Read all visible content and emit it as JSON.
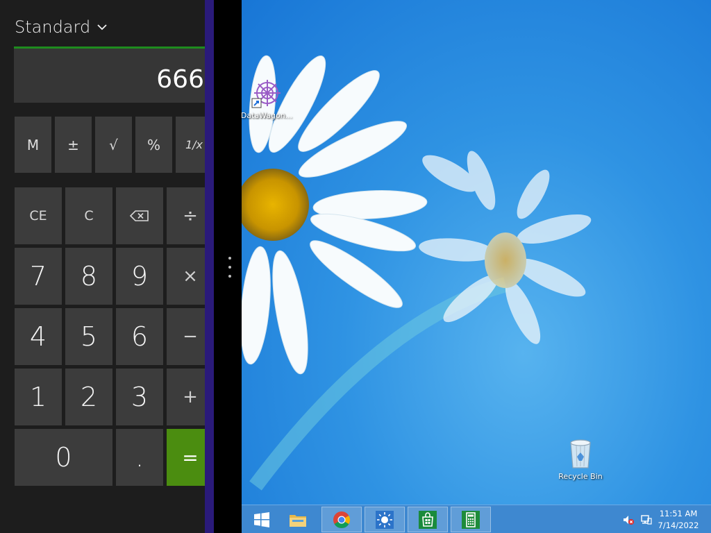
{
  "calculator": {
    "mode": "Standard",
    "display_value": "666",
    "memory_keys": [
      "M",
      "±",
      "√",
      "%",
      "1/x"
    ],
    "keys": {
      "ce": "CE",
      "c": "C",
      "divide": "÷",
      "seven": "7",
      "eight": "8",
      "nine": "9",
      "multiply": "×",
      "four": "4",
      "five": "5",
      "six": "6",
      "minus": "−",
      "one": "1",
      "two": "2",
      "three": "3",
      "plus": "+",
      "zero": "0",
      "point": ".",
      "equals": "="
    },
    "accent_color": "#1e8c1e",
    "equals_color": "#4b8d10"
  },
  "desktop": {
    "icons": [
      {
        "label": "DataWagon...",
        "icon": "datawagon-shortcut-icon"
      },
      {
        "label": "Recycle Bin",
        "icon": "recycle-bin-icon"
      }
    ]
  },
  "taskbar": {
    "items": [
      "start-icon",
      "file-explorer-icon",
      "chrome-icon",
      "weather-app-icon",
      "store-icon",
      "calculator-app-icon"
    ],
    "tray": {
      "time": "11:51 AM",
      "date": "7/14/2022",
      "icons": [
        "volume-muted-icon",
        "network-icon"
      ]
    }
  }
}
